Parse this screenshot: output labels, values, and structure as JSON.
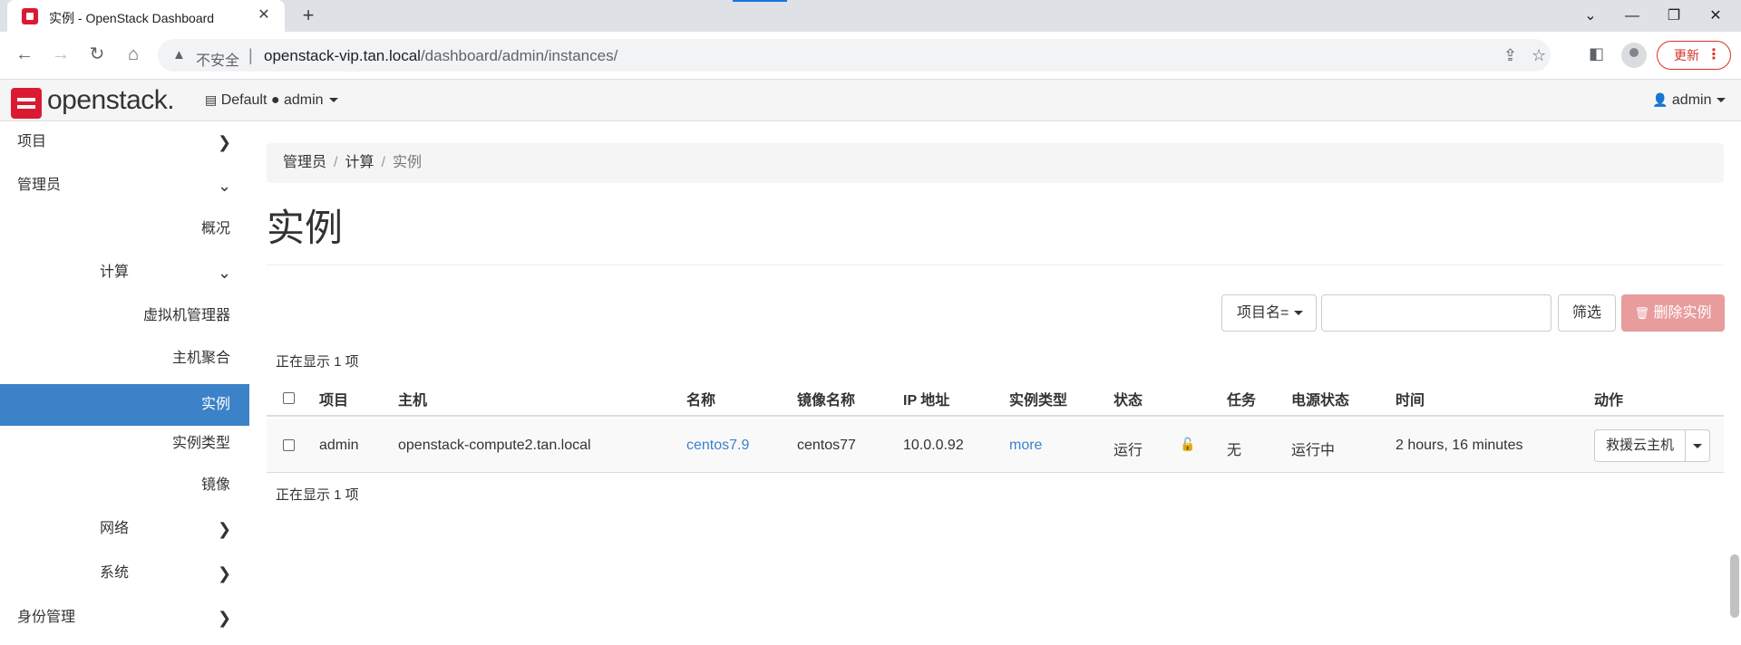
{
  "browser": {
    "tab_title": "实例 - OpenStack Dashboard",
    "tab_close": "✕",
    "new_tab": "+",
    "insecure_label": "不安全",
    "separator": "|",
    "url_host": "openstack-vip.tan.local",
    "url_path": "/dashboard/admin/instances/",
    "update_label": "更新"
  },
  "header": {
    "logo_text": "openstack.",
    "domain_label": "Default",
    "project_label": "admin",
    "user_label": "admin"
  },
  "sidebar": {
    "project": "项目",
    "admin": "管理员",
    "overview": "概况",
    "compute": "计算",
    "hypervisors": "虚拟机管理器",
    "aggregates": "主机聚合",
    "instances": "实例",
    "flavors": "实例类型",
    "images": "镜像",
    "network": "网络",
    "system": "系统",
    "identity": "身份管理"
  },
  "breadcrumb": {
    "admin": "管理员",
    "compute": "计算",
    "current": "实例",
    "sep": "/"
  },
  "page": {
    "title": "实例",
    "filter_field": "项目名=",
    "filter_button": "筛选",
    "delete_button": "删除实例",
    "count_top": "正在显示 1 项",
    "count_bottom": "正在显示 1 项"
  },
  "table": {
    "headers": {
      "project": "项目",
      "host": "主机",
      "name": "名称",
      "image": "镜像名称",
      "ip": "IP 地址",
      "flavor": "实例类型",
      "status": "状态",
      "task": "任务",
      "power": "电源状态",
      "time": "时间",
      "actions": "动作"
    },
    "rows": [
      {
        "project": "admin",
        "host": "openstack-compute2.tan.local",
        "name": "centos7.9",
        "image": "centos77",
        "ip": "10.0.0.92",
        "flavor": "more",
        "status": "运行",
        "task": "无",
        "power": "运行中",
        "time": "2 hours, 16 minutes",
        "action": "救援云主机"
      }
    ]
  },
  "colors": {
    "brand_red": "#da1a32",
    "active_blue": "#3c82c8",
    "danger_disabled": "#e89c9c"
  }
}
